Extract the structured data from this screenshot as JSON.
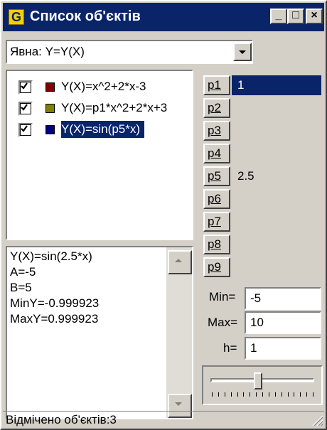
{
  "window": {
    "title": "Список об'єктів",
    "app_icon_letter": "G",
    "controls": {
      "minimize": "_",
      "maximize": "□",
      "close": "×"
    }
  },
  "type_select": {
    "value": "Явна: Y=Y(X)"
  },
  "functions": [
    {
      "label": "Y(X)=x^2+2*x-3",
      "checked": true,
      "color": "#800000",
      "selected": false
    },
    {
      "label": "Y(X)=p1*x^2+2*x+3",
      "checked": true,
      "color": "#808000",
      "selected": false
    },
    {
      "label": "Y(X)=sin(p5*x)",
      "checked": true,
      "color": "#000080",
      "selected": true
    }
  ],
  "info_lines": [
    "Y(X)=sin(2.5*x)",
    "A=-5",
    "B=5",
    "MinY=-0.999923",
    "MaxY=0.999923"
  ],
  "params": [
    {
      "name": "p1",
      "value": "1",
      "selected": true
    },
    {
      "name": "p2",
      "value": ""
    },
    {
      "name": "p3",
      "value": ""
    },
    {
      "name": "p4",
      "value": ""
    },
    {
      "name": "p5",
      "value": "2.5"
    },
    {
      "name": "p6",
      "value": ""
    },
    {
      "name": "p7",
      "value": ""
    },
    {
      "name": "p8",
      "value": ""
    },
    {
      "name": "p9",
      "value": ""
    }
  ],
  "range": {
    "min_label": "Min=",
    "min_value": "-5",
    "max_label": "Max=",
    "max_value": "10",
    "h_label": "h=",
    "h_value": "1"
  },
  "slider": {
    "position_fraction": 0.46,
    "tick_count": 17
  },
  "status": {
    "text": "Відмічено об'єктів:3"
  }
}
